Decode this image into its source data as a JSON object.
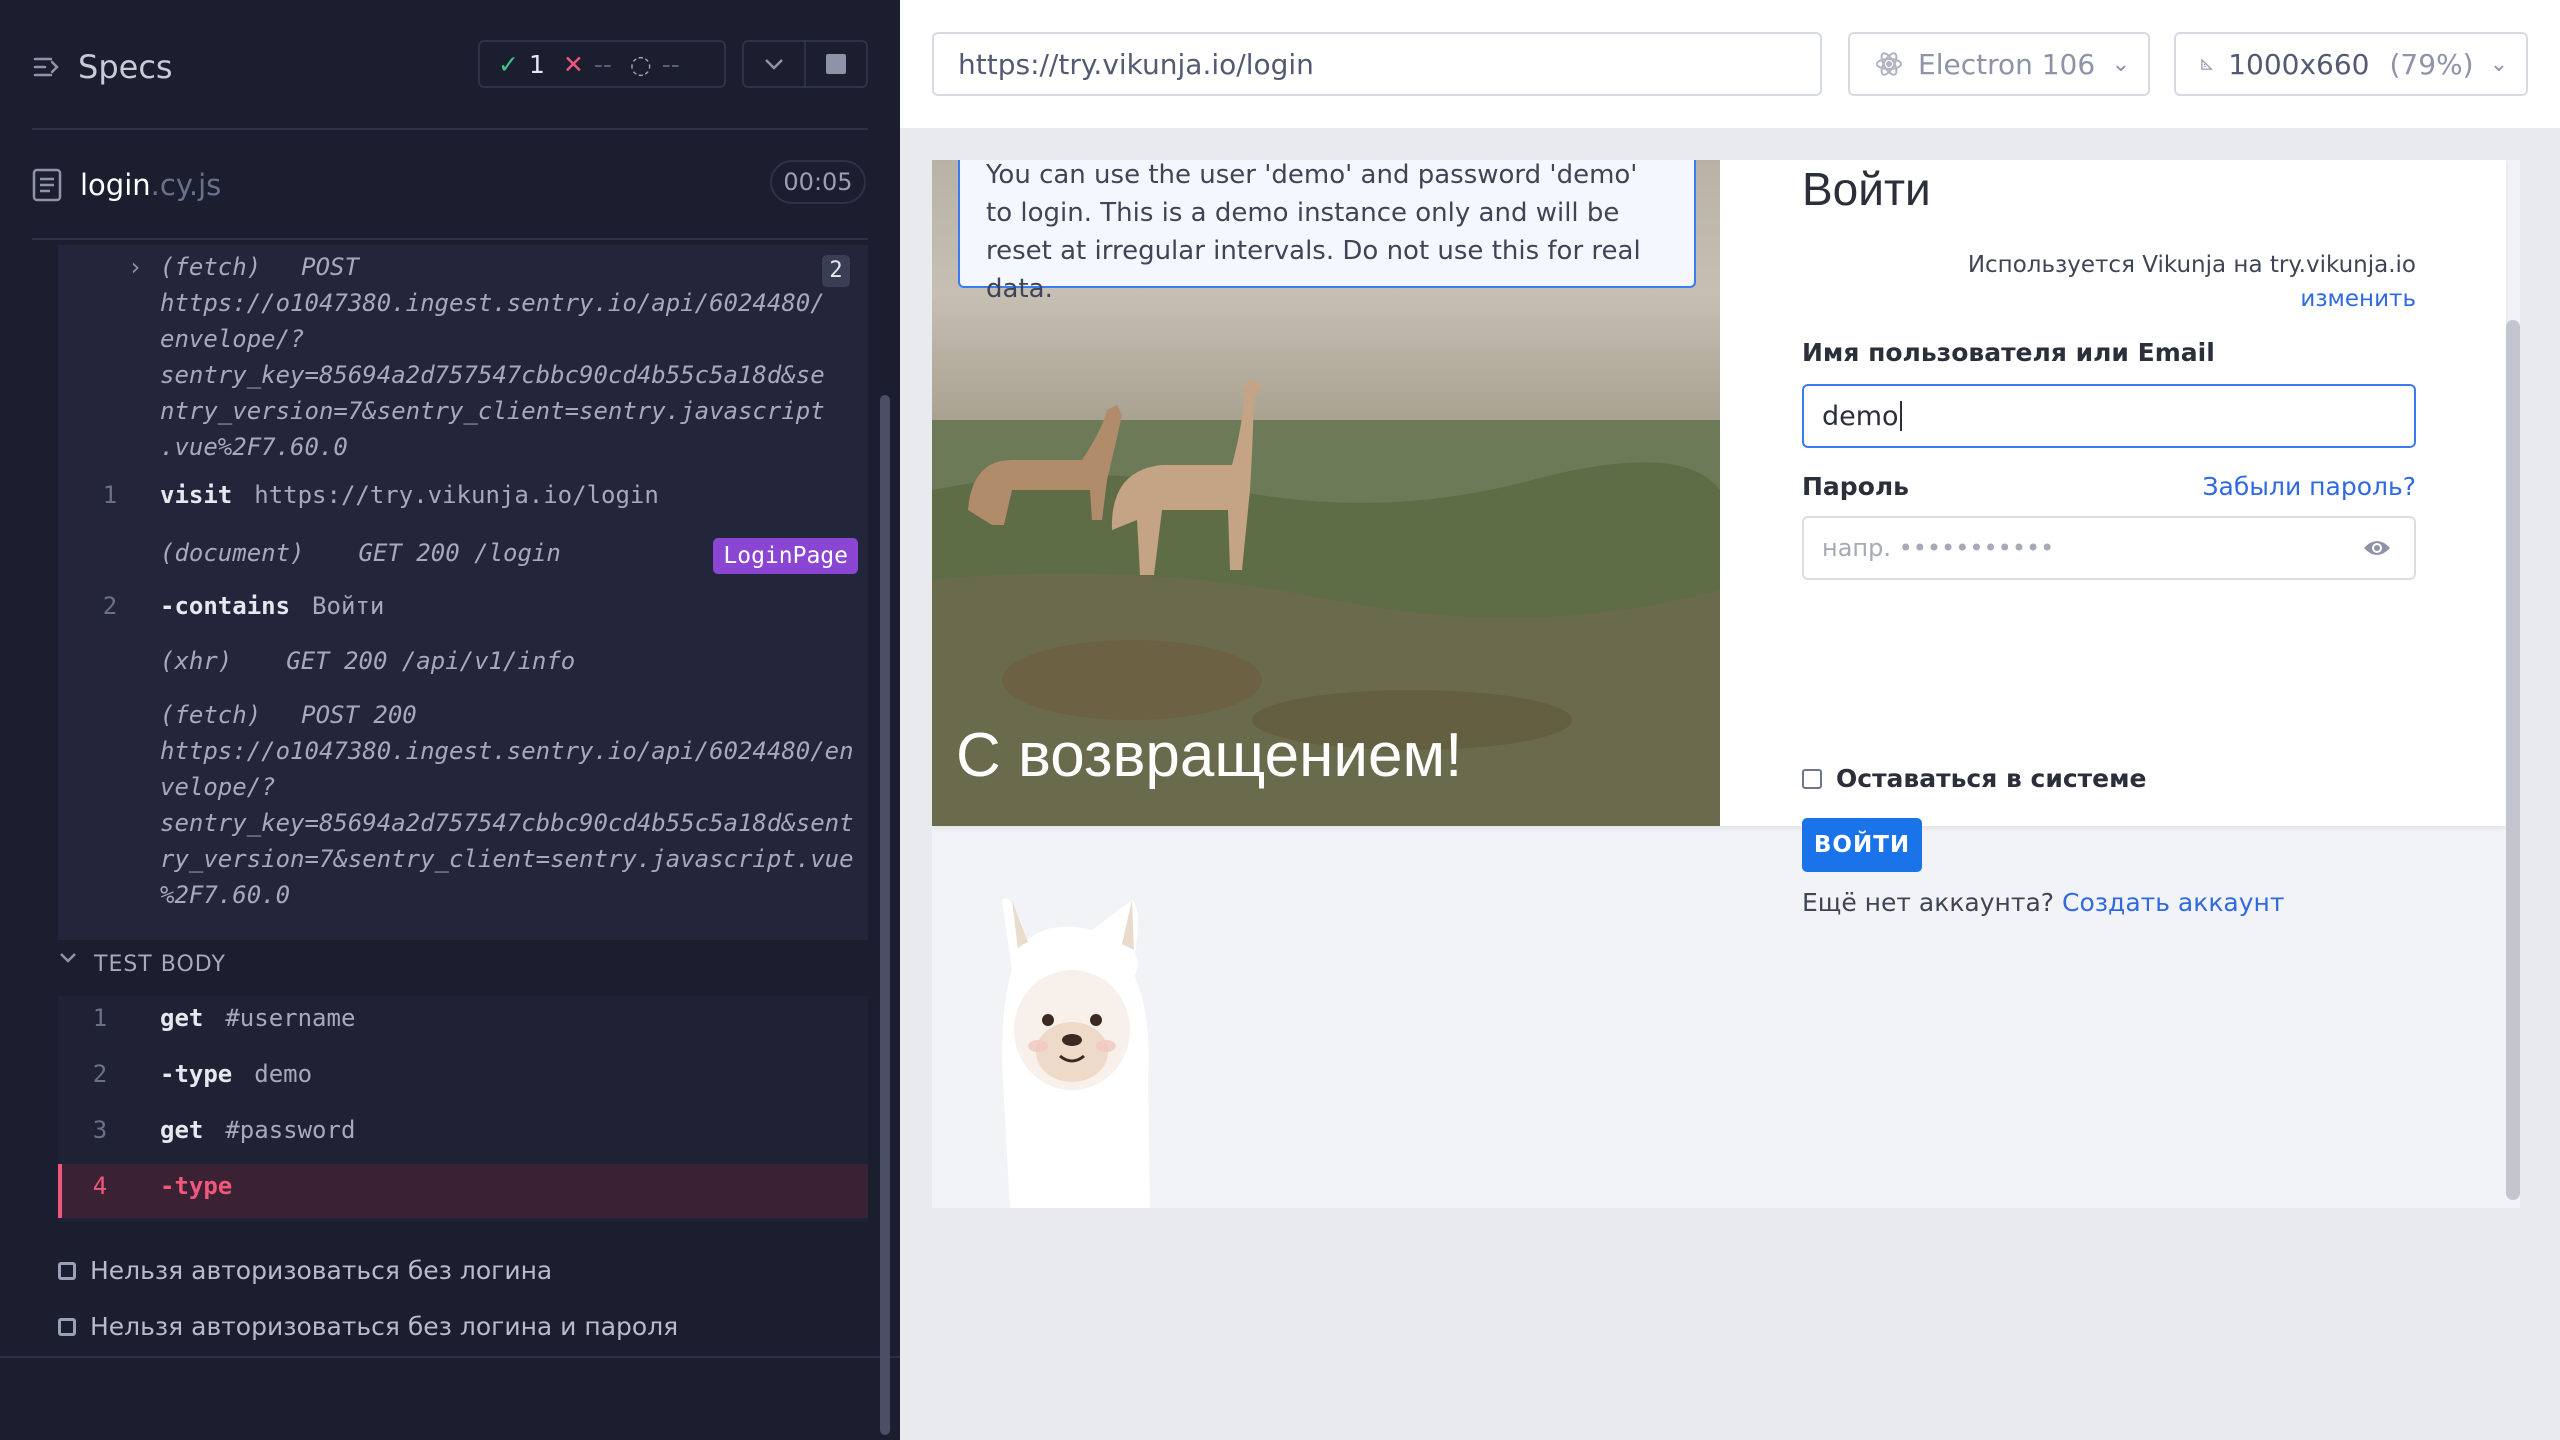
{
  "reporter": {
    "title": "Specs",
    "stats": {
      "passed": "1",
      "failed": "--",
      "pending": "--"
    },
    "spec": {
      "name": "login",
      "ext": ".cy.js",
      "duration": "00:05"
    },
    "log": [
      {
        "kind": "fetch-collapsed",
        "label": "(fetch)",
        "method": "POST",
        "lines": [
          "https://o1047380.ingest.sentry.io/api/6024480/",
          "envelope/?",
          "sentry_key=85694a2d757547cbbc90cd4b55c5a18d&se",
          "ntry_version=7&sentry_client=sentry.javascript",
          ".vue%2F7.60.0"
        ],
        "count": "2"
      },
      {
        "idx": "1",
        "name": "visit",
        "arg": "https://try.vikunja.io/login"
      },
      {
        "label": "(document)",
        "text": "GET 200 /login",
        "alias": "LoginPage"
      },
      {
        "idx": "2",
        "name": "-contains",
        "arg": "Войти"
      },
      {
        "label": "(xhr)",
        "text": "GET 200 /api/v1/info"
      },
      {
        "label": "(fetch)",
        "text": "POST 200",
        "lines": [
          "https://o1047380.ingest.sentry.io/api/6024480/en",
          "velope/?",
          "sentry_key=85694a2d757547cbbc90cd4b55c5a18d&sent",
          "ry_version=7&sentry_client=sentry.javascript.vue",
          "%2F7.60.0"
        ]
      }
    ],
    "test_body_label": "TEST BODY",
    "test_body": [
      {
        "idx": "1",
        "name": "get",
        "arg": "#username"
      },
      {
        "idx": "2",
        "name": "-type",
        "arg": "demo"
      },
      {
        "idx": "3",
        "name": "get",
        "arg": "#password"
      },
      {
        "idx": "4",
        "name": "-type",
        "arg": ""
      }
    ],
    "other_tests": [
      "Нельзя авторизоваться без логина",
      "Нельзя авторизоваться без логина и пароля"
    ]
  },
  "toolbar": {
    "url": "https://try.vikunja.io/login",
    "browser": "Electron 106",
    "viewport": "1000x660",
    "zoom": "(79%)"
  },
  "app": {
    "demo_note": "You can use the user 'demo' and password 'demo' to login. This is a demo instance only and will be reset at irregular intervals. Do not use this for real data.",
    "hero_text": "С возвращением!",
    "title": "Войти",
    "used_on": "Используется Vikunja на try.vikunja.io",
    "change": "изменить",
    "username_label": "Имя пользователя или Email",
    "username_value": "demo",
    "password_label": "Пароль",
    "forgot": "Забыли пароль?",
    "password_placeholder": "напр. •••••••••••",
    "remember": "Оставаться в системе",
    "login_button": "ВОЙТИ",
    "no_account": "Ещё нет аккаунта?",
    "create_account": "Создать аккаунт"
  },
  "colors": {
    "accent": "#1a73e8",
    "pass": "#3fc48b",
    "fail": "#f0577c",
    "alias": "#8a46d3"
  }
}
